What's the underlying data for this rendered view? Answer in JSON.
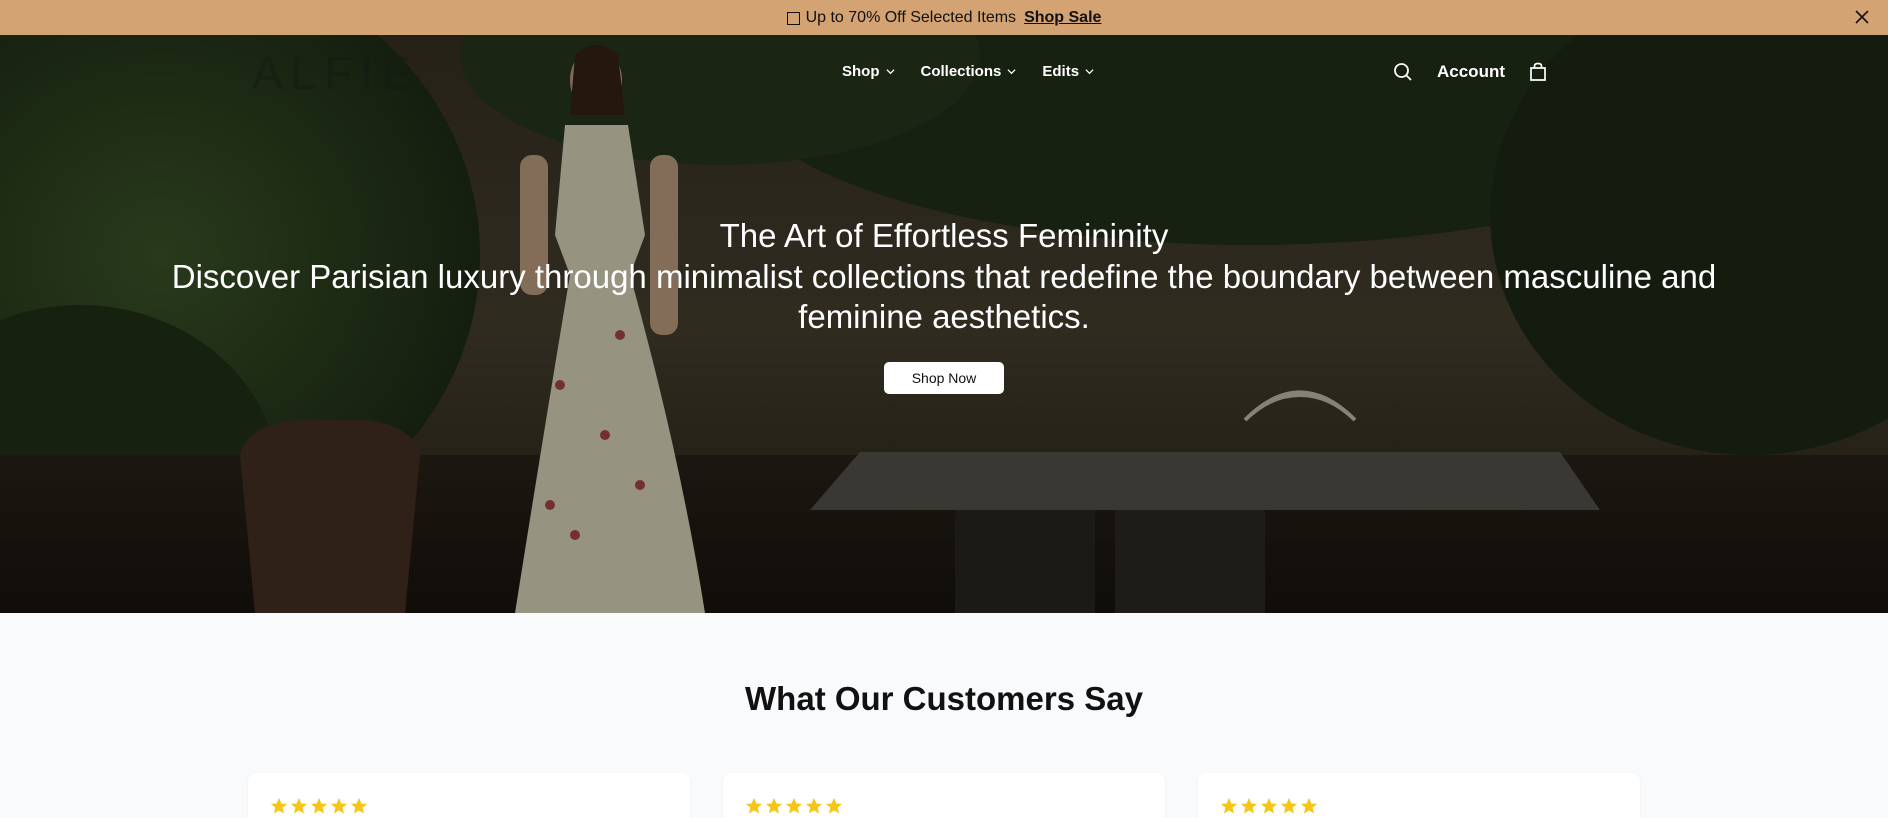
{
  "announcement": {
    "icon": "gift-icon",
    "text": "Up to 70% Off Selected Items",
    "link_label": "Shop Sale",
    "close_icon": "close-icon"
  },
  "header": {
    "logo_text": "ALFIE",
    "nav": [
      {
        "label": "Shop"
      },
      {
        "label": "Collections"
      },
      {
        "label": "Edits"
      }
    ],
    "account_label": "Account",
    "icons": [
      "search-icon",
      "bag-icon"
    ]
  },
  "hero": {
    "title": "The Art of Effortless Femininity",
    "subtitle": "Discover Parisian luxury through minimalist collections that redefine the boundary between masculine and feminine aesthetics.",
    "cta_label": "Shop Now"
  },
  "testimonials": {
    "title": "What Our Customers Say",
    "cards": [
      {
        "rating": 5
      },
      {
        "rating": 5
      },
      {
        "rating": 5
      }
    ]
  },
  "colors": {
    "announcement_bg": "#d4a373",
    "star": "#f5c518",
    "page_bg": "#f8fafc"
  }
}
